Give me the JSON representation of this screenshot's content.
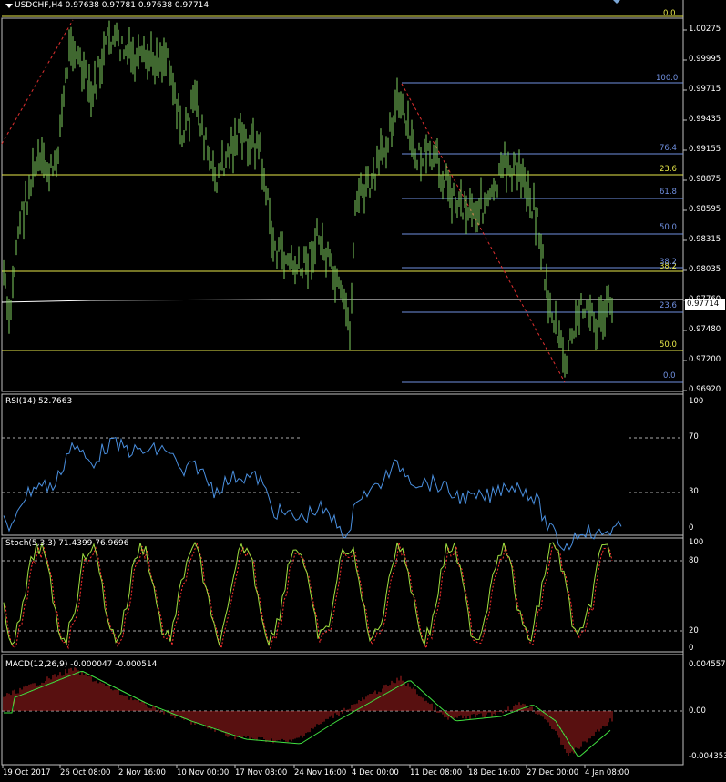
{
  "header": {
    "symbol_title": "USDCHF,H4  0.97638 0.97781 0.97638 0.97714"
  },
  "main_chart": {
    "price_ticks": [
      "1.00275",
      "0.99995",
      "0.99715",
      "0.99435",
      "0.99155",
      "0.98875",
      "0.98595",
      "0.98315",
      "0.98035",
      "0.97760",
      "0.97480",
      "0.97200",
      "0.96920"
    ],
    "current_price": "0.97714",
    "fib_yellow_levels": [
      "0.0",
      "23.6",
      "38.2",
      "50.0"
    ],
    "fib_blue_levels": [
      "100.0",
      "76.4",
      "61.8",
      "50.0",
      "38.2",
      "23.6",
      "0.0"
    ]
  },
  "rsi": {
    "label": "RSI(14) 52.7663",
    "ticks": [
      "100",
      "70",
      "30",
      "0"
    ]
  },
  "stoch": {
    "label": "Stoch(5,3,3) 71.4399 76.9696",
    "ticks": [
      "100",
      "80",
      "20",
      "0"
    ]
  },
  "macd": {
    "label": "MACD(12,26,9) -0.000047 -0.000514",
    "ticks": [
      "0.004557",
      "0.00",
      "-0.004353"
    ]
  },
  "time_axis": [
    "19 Oct 2017",
    "26 Oct 08:00",
    "2 Nov 16:00",
    "10 Nov 00:00",
    "17 Nov 08:00",
    "24 Nov 16:00",
    "4 Dec 00:00",
    "11 Dec 08:00",
    "18 Dec 16:00",
    "27 Dec 00:00",
    "4 Jan 08:00"
  ],
  "colors": {
    "background": "#000000",
    "candle": "#7fd160",
    "fib_yellow": "#e8e84a",
    "fib_blue": "#7090e0",
    "rsi_line": "#4a90e0",
    "stoch_main": "#a0e040",
    "stoch_signal": "#ff3030",
    "macd_hist": "#b02020",
    "macd_signal": "#40e040"
  }
}
